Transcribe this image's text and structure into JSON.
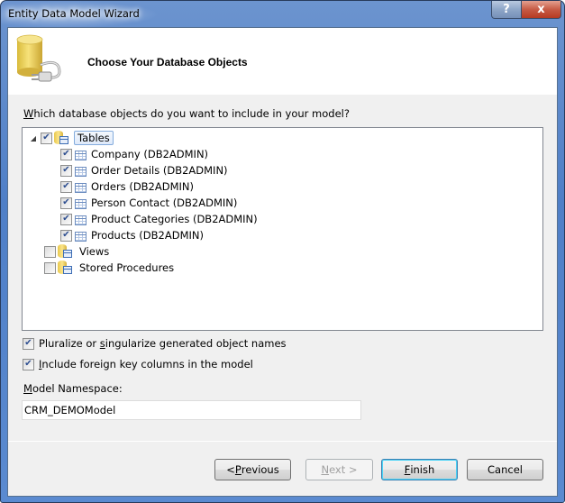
{
  "window": {
    "title": "Entity Data Model Wizard",
    "help_label": "?",
    "close_label": "x"
  },
  "header": {
    "title": "Choose Your Database Objects",
    "icon": "database-plug-icon"
  },
  "prompt": {
    "accel": "W",
    "rest": "hich database objects do you want to include in your model?"
  },
  "tree": {
    "tables": {
      "label": "Tables",
      "checked": true,
      "expanded": true,
      "items": [
        {
          "label": "Company (DB2ADMIN)",
          "checked": true
        },
        {
          "label": "Order Details (DB2ADMIN)",
          "checked": true
        },
        {
          "label": "Orders (DB2ADMIN)",
          "checked": true
        },
        {
          "label": "Person Contact (DB2ADMIN)",
          "checked": true
        },
        {
          "label": "Product Categories (DB2ADMIN)",
          "checked": true
        },
        {
          "label": "Products (DB2ADMIN)",
          "checked": true
        }
      ]
    },
    "views": {
      "label": "Views",
      "checked": false
    },
    "stored_procedures": {
      "label": "Stored Procedures",
      "checked": false
    }
  },
  "options": {
    "pluralize": {
      "pre": "Pluralize or ",
      "accel": "s",
      "post": "ingularize generated object names",
      "checked": true
    },
    "foreign_keys": {
      "pre": "",
      "accel": "I",
      "post": "nclude foreign key columns in the model",
      "checked": true
    }
  },
  "namespace": {
    "label_accel": "M",
    "label_rest": "odel Namespace:",
    "value": "CRM_DEMOModel"
  },
  "buttons": {
    "previous": {
      "pre": "< ",
      "accel": "P",
      "post": "revious"
    },
    "next": {
      "pre": "",
      "accel": "N",
      "post": "ext >"
    },
    "finish": {
      "pre": "",
      "accel": "F",
      "post": "inish"
    },
    "cancel": {
      "label": "Cancel"
    }
  }
}
